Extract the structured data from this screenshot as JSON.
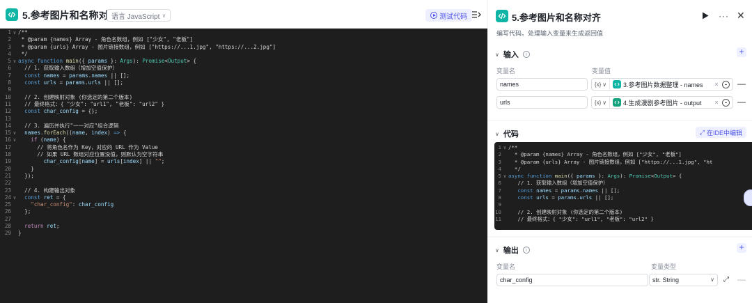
{
  "editor": {
    "title": "5.参考图片和名称对齐",
    "language_select": "语言 JavaScript",
    "test_button": "测试代码",
    "lines": [
      {
        "n": "1",
        "fold": "∨",
        "t": "/**",
        "c": "com"
      },
      {
        "n": "2",
        "fold": "",
        "t": " * @param {names} Array - 角色名数组，例如 [\"少女\", \"老板\"]",
        "c": "com"
      },
      {
        "n": "3",
        "fold": "",
        "t": " * @param {urls} Array - 图片链接数组，例如 [\"https://...1.jpg\", \"https://...2.jpg\"]",
        "c": "com"
      },
      {
        "n": "4",
        "fold": "",
        "t": " */",
        "c": "com"
      },
      {
        "n": "5",
        "fold": "∨",
        "t": "",
        "c": "fn5"
      },
      {
        "n": "6",
        "fold": "",
        "t": "  // 1. 获取输入数组（增加空值保护）",
        "c": "com"
      },
      {
        "n": "7",
        "fold": "",
        "t": "",
        "c": "l7"
      },
      {
        "n": "8",
        "fold": "",
        "t": "",
        "c": "l8"
      },
      {
        "n": "9",
        "fold": "",
        "t": "",
        "c": ""
      },
      {
        "n": "10",
        "fold": "",
        "t": "  // 2. 创建映射对象 (你选定的第二个版本)",
        "c": "com"
      },
      {
        "n": "11",
        "fold": "",
        "t": "  // 最终格式：{ \"少女\": \"url1\", \"老板\": \"url2\" }",
        "c": "com"
      },
      {
        "n": "12",
        "fold": "",
        "t": "",
        "c": "l12"
      },
      {
        "n": "13",
        "fold": "",
        "t": "",
        "c": ""
      },
      {
        "n": "14",
        "fold": "",
        "t": "  // 3. 遍历并执行\"一一对应\"组合逻辑",
        "c": "com"
      },
      {
        "n": "15",
        "fold": "∨",
        "t": "",
        "c": "l15"
      },
      {
        "n": "16",
        "fold": "∨",
        "t": "",
        "c": "l16"
      },
      {
        "n": "17",
        "fold": "",
        "t": "      // 将角色名作为 Key，对应的 URL 作为 Value",
        "c": "com"
      },
      {
        "n": "18",
        "fold": "",
        "t": "      // 如果 URL 数组对应位置没值，则默认为空字符串",
        "c": "com"
      },
      {
        "n": "19",
        "fold": "",
        "t": "",
        "c": "l19"
      },
      {
        "n": "20",
        "fold": "",
        "t": "    }",
        "c": ""
      },
      {
        "n": "21",
        "fold": "",
        "t": "  });",
        "c": ""
      },
      {
        "n": "22",
        "fold": "",
        "t": "",
        "c": ""
      },
      {
        "n": "23",
        "fold": "",
        "t": "  // 4. 构建输出对象",
        "c": "com"
      },
      {
        "n": "24",
        "fold": "∨",
        "t": "",
        "c": "l24"
      },
      {
        "n": "25",
        "fold": "",
        "t": "",
        "c": "l25"
      },
      {
        "n": "26",
        "fold": "",
        "t": "  };",
        "c": ""
      },
      {
        "n": "27",
        "fold": "",
        "t": "",
        "c": ""
      },
      {
        "n": "28",
        "fold": "",
        "t": "",
        "c": "l28"
      },
      {
        "n": "29",
        "fold": "",
        "t": "}",
        "c": ""
      }
    ]
  },
  "panel": {
    "title": "5.参考图片和名称对齐",
    "description": "编写代码。处理输入变量来生成返回值",
    "input": {
      "heading": "输入",
      "col_name": "变量名",
      "col_value": "变量值",
      "rows": [
        {
          "name": "names",
          "ref": "3.参考图片数据整理 - names",
          "node_color": "#0fb5a5",
          "node_icon": "code-icon"
        },
        {
          "name": "urls",
          "ref": "4.生成漫剧参考图片 - output",
          "node_color": "#14a37f",
          "node_icon": "image-gen-icon"
        }
      ]
    },
    "code": {
      "heading": "代码",
      "ide_button": "在IDE中编辑",
      "lines": [
        {
          "n": "1",
          "fold": "∨",
          "t": "/**",
          "c": "com"
        },
        {
          "n": "2",
          "fold": "",
          "t": "  * @param {names} Array - 角色名数组，例如 [\"少女\", \"老板\"]",
          "c": "com"
        },
        {
          "n": "3",
          "fold": "",
          "t": "  * @param {urls} Array - 图片链接数组，例如 [\"https://...1.jpg\", \"ht",
          "c": "com"
        },
        {
          "n": "4",
          "fold": "",
          "t": "  */",
          "c": "com"
        },
        {
          "n": "5",
          "fold": "∨",
          "t": "",
          "c": "fn5"
        },
        {
          "n": "6",
          "fold": "",
          "t": "   // 1. 获取输入数组（增加空值保护）",
          "c": "com"
        },
        {
          "n": "7",
          "fold": "",
          "t": "",
          "c": "l7"
        },
        {
          "n": "8",
          "fold": "",
          "t": "",
          "c": "l8"
        },
        {
          "n": "9",
          "fold": "",
          "t": "",
          "c": ""
        },
        {
          "n": "10",
          "fold": "",
          "t": "   // 2. 创建映射对象 (你选定的第二个版本)",
          "c": "com"
        },
        {
          "n": "11",
          "fold": "",
          "t": "   // 最终格式：{ \"少女\": \"url1\", \"老板\": \"url2\" }",
          "c": "com"
        }
      ]
    },
    "output": {
      "heading": "输出",
      "col_name": "变量名",
      "col_type": "变量类型",
      "rows": [
        {
          "name": "char_config",
          "type": "str. String"
        }
      ]
    }
  }
}
